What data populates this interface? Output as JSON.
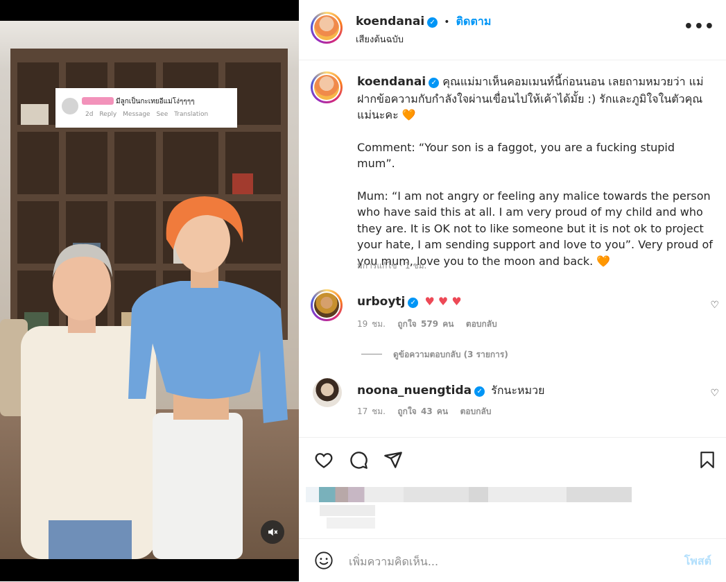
{
  "video_overlay": {
    "comment_text": "มีลูกเป็นกะเทยอีแม่โง่ๆๆๆๆ",
    "age": "2d",
    "reply": "Reply",
    "message": "Message",
    "translate": "See Translation"
  },
  "post_header": {
    "username": "koendanai",
    "separator": "•",
    "follow_label": "ติดตาม",
    "audio_label": "เสียงต้นฉบับ",
    "more_icon": "more-horizontal-icon"
  },
  "caption": {
    "username": "koendanai",
    "line1": "คุณแม่มาเห็นคอมเมนท์นี้ก่อนนอน เลยถามหมวยว่า แม่ฝากข้อความกับกำลังใจผ่านเขื่อนไปให้เค้าได้มั้ย :) รักและภูมิใจในตัวคุณแม่นะคะ",
    "line1_emoji": "🧡",
    "comment_quote": "Comment: “Your son is a faggot, you are a fucking stupid mum”.",
    "mum_quote": "Mum: “I am not angry or feeling any malice towards the person who have said this at all. I am very proud of my child and who they are. It is OK not to like someone but it is not ok to project your hate, I am sending support and love to you”. Very proud of you mum, love you to the moon and back.",
    "mum_emoji": "🧡",
    "edited": "มีการแก้ไข · 1 ชม."
  },
  "comments": [
    {
      "username": "urboytj",
      "text": "♥ ♥ ♥",
      "time": "19 ชม.",
      "likes": "ถูกใจ 579 คน",
      "reply": "ตอบกลับ"
    },
    {
      "username": "noona_nuengtida",
      "text": "รักนะหมวย",
      "time": "17 ชม.",
      "likes": "ถูกใจ 43 คน",
      "reply": "ตอบกลับ"
    }
  ],
  "view_replies": "ดูข้อความตอบกลับ (3 รายการ)",
  "actions": {
    "like_icon": "heart-icon",
    "comment_icon": "comment-icon",
    "share_icon": "send-icon",
    "save_icon": "bookmark-icon"
  },
  "add_comment": {
    "placeholder": "เพิ่มความคิดเห็น...",
    "post_label": "โพสต์",
    "emoji_icon": "smiley-icon"
  },
  "colors": {
    "accent": "#0095f6",
    "heart": "#ed4956",
    "orange_heart": "#f47b20",
    "post_disabled": "#b2dffc"
  }
}
